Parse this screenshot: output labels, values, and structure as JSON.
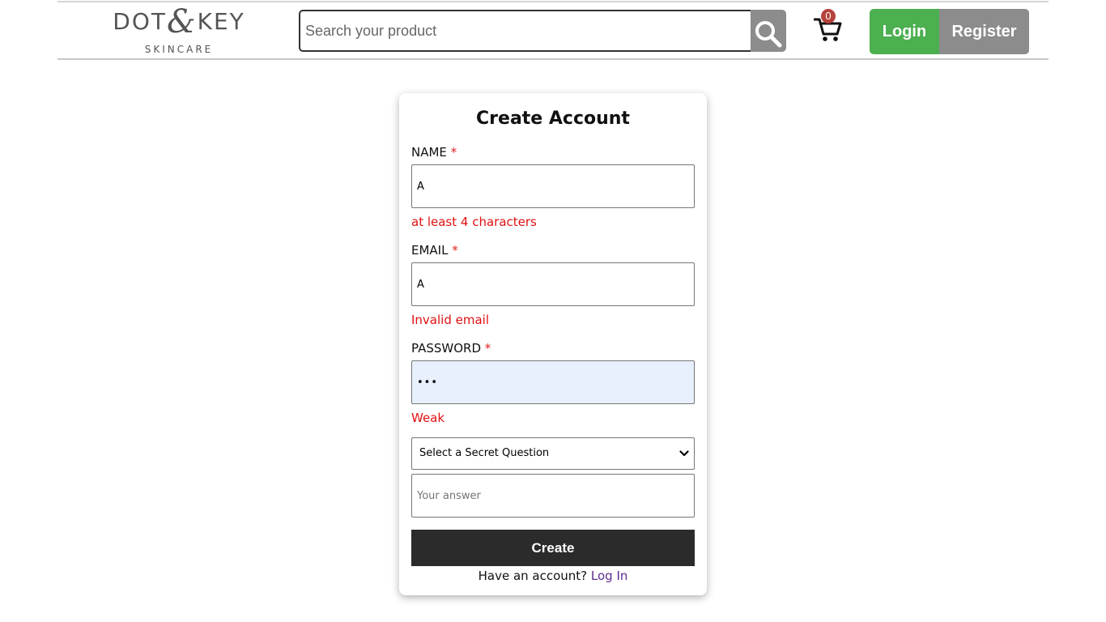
{
  "header": {
    "logo_main_left": "DOT",
    "logo_amp": "&",
    "logo_main_right": "KEY",
    "logo_sub": "SKINCARE",
    "search_placeholder": "Search your product",
    "search_icon": "search-icon",
    "cart_icon": "cart-icon",
    "cart_count": "0",
    "login_label": "Login",
    "register_label": "Register",
    "colors": {
      "login_bg": "#4caf50",
      "register_bg": "#8c8c8c",
      "search_button_bg": "#8c8c8c",
      "cart_badge_bg": "#b5423a"
    }
  },
  "form": {
    "title": "Create Account",
    "required_marker": "*",
    "name": {
      "label": "NAME",
      "value": "A",
      "error": "at least 4 characters"
    },
    "email": {
      "label": "EMAIL",
      "value": "A",
      "error": "Invalid email"
    },
    "password": {
      "label": "PASSWORD",
      "value": "•••",
      "error": "Weak"
    },
    "secret_question": {
      "selected": "Select a Secret Question"
    },
    "answer": {
      "placeholder": "Your answer",
      "value": ""
    },
    "create_label": "Create",
    "footer_prompt": "Have an account?",
    "footer_link": "Log In",
    "colors": {
      "error": "#e01010",
      "create_bg": "#2b2b2b",
      "link": "#5b2c8f",
      "autofill_bg": "#e8f0fe"
    }
  }
}
